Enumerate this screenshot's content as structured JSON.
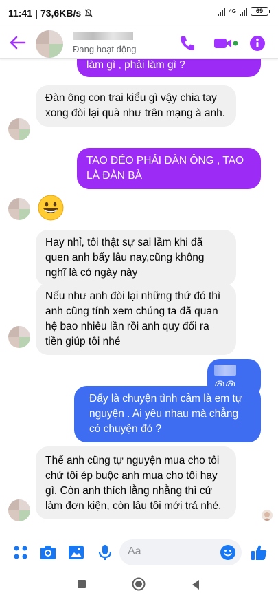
{
  "status_bar": {
    "time": "11:41",
    "speed": "73,6KB/s",
    "network": "4G",
    "battery": "69"
  },
  "header": {
    "status": "Đang hoạt động"
  },
  "messages": [
    {
      "from": "me",
      "color": "purple",
      "text": "làm gì , phải làm gì ?"
    },
    {
      "from": "them",
      "text": "Đàn ông con trai kiểu gì vậy chia tay xong đòi lại quà như trên mạng à anh."
    },
    {
      "from": "me",
      "color": "purple",
      "text": "TAO ĐÉO PHẢI ĐÀN ÔNG , TAO LÀ ĐÀN BÀ"
    },
    {
      "from": "them",
      "emoji": "grinning-face"
    },
    {
      "from": "them",
      "text": "Hay nhỉ, tôi thật sự sai lầm khi đã quen anh bấy lâu nay,cũng không nghĩ là có ngày này"
    },
    {
      "from": "them",
      "text": "Nếu như anh đòi lại những thứ đó thì anh cũng tính xem chúng ta đã quan hệ bao nhiêu lần rồi anh quy đổi ra tiền giúp tôi nhé"
    },
    {
      "from": "me",
      "color": "blue",
      "text": "@@"
    },
    {
      "from": "me",
      "color": "blue",
      "text": "Đấy là chuyện tình cảm là em tự nguyện . Ai yêu nhau mà chẳng có chuyện đó ?"
    },
    {
      "from": "them",
      "text": "Thế anh cũng tự nguyện mua cho tôi chứ tôi ép buộc anh mua cho tôi hay gì. Còn anh thích lằng nhằng thì cứ làm đơn kiện, còn lâu tôi mới trả nhé."
    }
  ],
  "composer": {
    "placeholder": "Aa"
  },
  "colors": {
    "accent": "#a033ff",
    "bubble_purple": "#9b2bf5",
    "bubble_blue": "#3e6df2",
    "bubble_incoming": "#f0f0f0",
    "icon_blue": "#1877f2",
    "online_green": "#31a24c"
  },
  "icons": {
    "back": "back-arrow-icon",
    "call": "phone-icon",
    "video": "video-camera-icon",
    "info": "info-icon",
    "apps": "four-dots-icon",
    "camera": "camera-icon",
    "gallery": "gallery-icon",
    "mic": "microphone-icon",
    "emoji": "smiley-icon",
    "like": "thumbs-up-icon"
  }
}
